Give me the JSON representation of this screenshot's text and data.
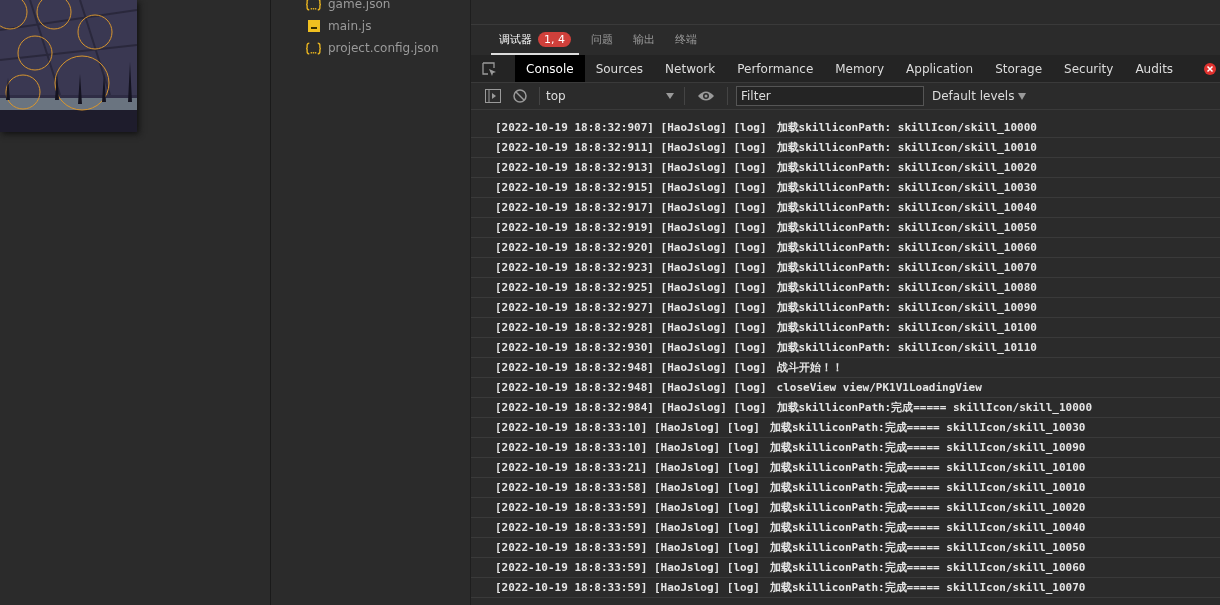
{
  "files": [
    {
      "name": "game.json",
      "kind": "json"
    },
    {
      "name": "main.js",
      "kind": "script"
    },
    {
      "name": "project.config.json",
      "kind": "json"
    }
  ],
  "panel_tabs": [
    {
      "label": "调试器",
      "selected": true,
      "badge": "1, 4"
    },
    {
      "label": "问题",
      "selected": false
    },
    {
      "label": "输出",
      "selected": false
    },
    {
      "label": "终端",
      "selected": false
    }
  ],
  "devtools_tabs": [
    {
      "label": "Console",
      "selected": true
    },
    {
      "label": "Sources",
      "selected": false
    },
    {
      "label": "Network",
      "selected": false
    },
    {
      "label": "Performance",
      "selected": false
    },
    {
      "label": "Memory",
      "selected": false
    },
    {
      "label": "Application",
      "selected": false
    },
    {
      "label": "Storage",
      "selected": false
    },
    {
      "label": "Security",
      "selected": false
    },
    {
      "label": "Audits",
      "selected": false
    }
  ],
  "toolbar": {
    "context": "top",
    "filter_placeholder": "Filter",
    "levels": "Default levels"
  },
  "log": [
    {
      "prefix": "[2022-10-19 18:8:32:907] [HaoJslog] [log]",
      "message": "加载skilliconPath: skillIcon/skill_10000"
    },
    {
      "prefix": "[2022-10-19 18:8:32:911] [HaoJslog] [log]",
      "message": "加载skilliconPath: skillIcon/skill_10010"
    },
    {
      "prefix": "[2022-10-19 18:8:32:913] [HaoJslog] [log]",
      "message": "加载skilliconPath: skillIcon/skill_10020"
    },
    {
      "prefix": "[2022-10-19 18:8:32:915] [HaoJslog] [log]",
      "message": "加载skilliconPath: skillIcon/skill_10030"
    },
    {
      "prefix": "[2022-10-19 18:8:32:917] [HaoJslog] [log]",
      "message": "加载skilliconPath: skillIcon/skill_10040"
    },
    {
      "prefix": "[2022-10-19 18:8:32:919] [HaoJslog] [log]",
      "message": "加载skilliconPath: skillIcon/skill_10050"
    },
    {
      "prefix": "[2022-10-19 18:8:32:920] [HaoJslog] [log]",
      "message": "加载skilliconPath: skillIcon/skill_10060"
    },
    {
      "prefix": "[2022-10-19 18:8:32:923] [HaoJslog] [log]",
      "message": "加载skilliconPath: skillIcon/skill_10070"
    },
    {
      "prefix": "[2022-10-19 18:8:32:925] [HaoJslog] [log]",
      "message": "加载skilliconPath: skillIcon/skill_10080"
    },
    {
      "prefix": "[2022-10-19 18:8:32:927] [HaoJslog] [log]",
      "message": "加载skilliconPath: skillIcon/skill_10090"
    },
    {
      "prefix": "[2022-10-19 18:8:32:928] [HaoJslog] [log]",
      "message": "加载skilliconPath: skillIcon/skill_10100"
    },
    {
      "prefix": "[2022-10-19 18:8:32:930] [HaoJslog] [log]",
      "message": "加载skilliconPath: skillIcon/skill_10110"
    },
    {
      "prefix": "[2022-10-19 18:8:32:948] [HaoJslog] [log]",
      "message": "战斗开始！！"
    },
    {
      "prefix": "[2022-10-19 18:8:32:948] [HaoJslog] [log]",
      "message": "closeView view/PK1V1LoadingView"
    },
    {
      "prefix": "[2022-10-19 18:8:32:984] [HaoJslog] [log]",
      "message": "加载skilliconPath:完成===== skillIcon/skill_10000"
    },
    {
      "prefix": "[2022-10-19 18:8:33:10] [HaoJslog] [log]",
      "message": "加载skilliconPath:完成===== skillIcon/skill_10030"
    },
    {
      "prefix": "[2022-10-19 18:8:33:10] [HaoJslog] [log]",
      "message": "加载skilliconPath:完成===== skillIcon/skill_10090"
    },
    {
      "prefix": "[2022-10-19 18:8:33:21] [HaoJslog] [log]",
      "message": "加载skilliconPath:完成===== skillIcon/skill_10100"
    },
    {
      "prefix": "[2022-10-19 18:8:33:58] [HaoJslog] [log]",
      "message": "加载skilliconPath:完成===== skillIcon/skill_10010"
    },
    {
      "prefix": "[2022-10-19 18:8:33:59] [HaoJslog] [log]",
      "message": "加载skilliconPath:完成===== skillIcon/skill_10020"
    },
    {
      "prefix": "[2022-10-19 18:8:33:59] [HaoJslog] [log]",
      "message": "加载skilliconPath:完成===== skillIcon/skill_10040"
    },
    {
      "prefix": "[2022-10-19 18:8:33:59] [HaoJslog] [log]",
      "message": "加载skilliconPath:完成===== skillIcon/skill_10050"
    },
    {
      "prefix": "[2022-10-19 18:8:33:59] [HaoJslog] [log]",
      "message": "加载skilliconPath:完成===== skillIcon/skill_10060"
    },
    {
      "prefix": "[2022-10-19 18:8:33:59] [HaoJslog] [log]",
      "message": "加载skilliconPath:完成===== skillIcon/skill_10070"
    }
  ]
}
